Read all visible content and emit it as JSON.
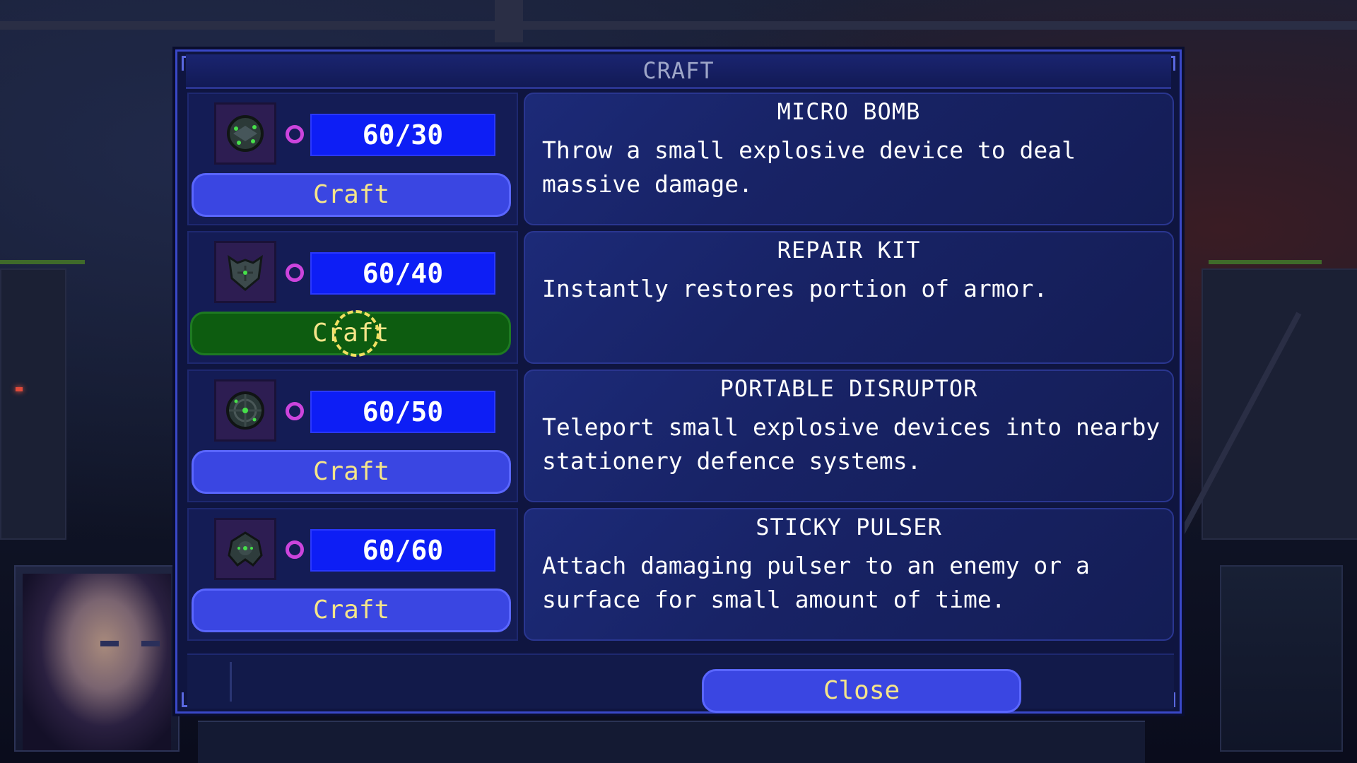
{
  "modal": {
    "title": "CRAFT"
  },
  "recipes": [
    {
      "icon": "micro-bomb-icon",
      "cost": "60/30",
      "craft_label": "Craft",
      "name": "MICRO BOMB",
      "description": "Throw a small explosive device to deal massive damage."
    },
    {
      "icon": "repair-kit-icon",
      "cost": "60/40",
      "craft_label": "Craft",
      "name": "REPAIR KIT",
      "description": "Instantly restores portion of armor."
    },
    {
      "icon": "portable-disruptor-icon",
      "cost": "60/50",
      "craft_label": "Craft",
      "name": "PORTABLE DISRUPTOR",
      "description": "Teleport small explosive devices into nearby stationery defence systems."
    },
    {
      "icon": "sticky-pulser-icon",
      "cost": "60/60",
      "craft_label": "Craft",
      "name": "STICKY PULSER",
      "description": "Attach damaging pulser to an enemy or a surface for small amount of time."
    }
  ],
  "footer": {
    "close_label": "Close"
  },
  "colors": {
    "panel": "#0f1540",
    "cost_box": "#0d1ef5",
    "craft_button": "#3a46e2",
    "craft_button_active": "#0d5c10",
    "button_text": "#f5e58a",
    "currency": "#cc44dd"
  }
}
